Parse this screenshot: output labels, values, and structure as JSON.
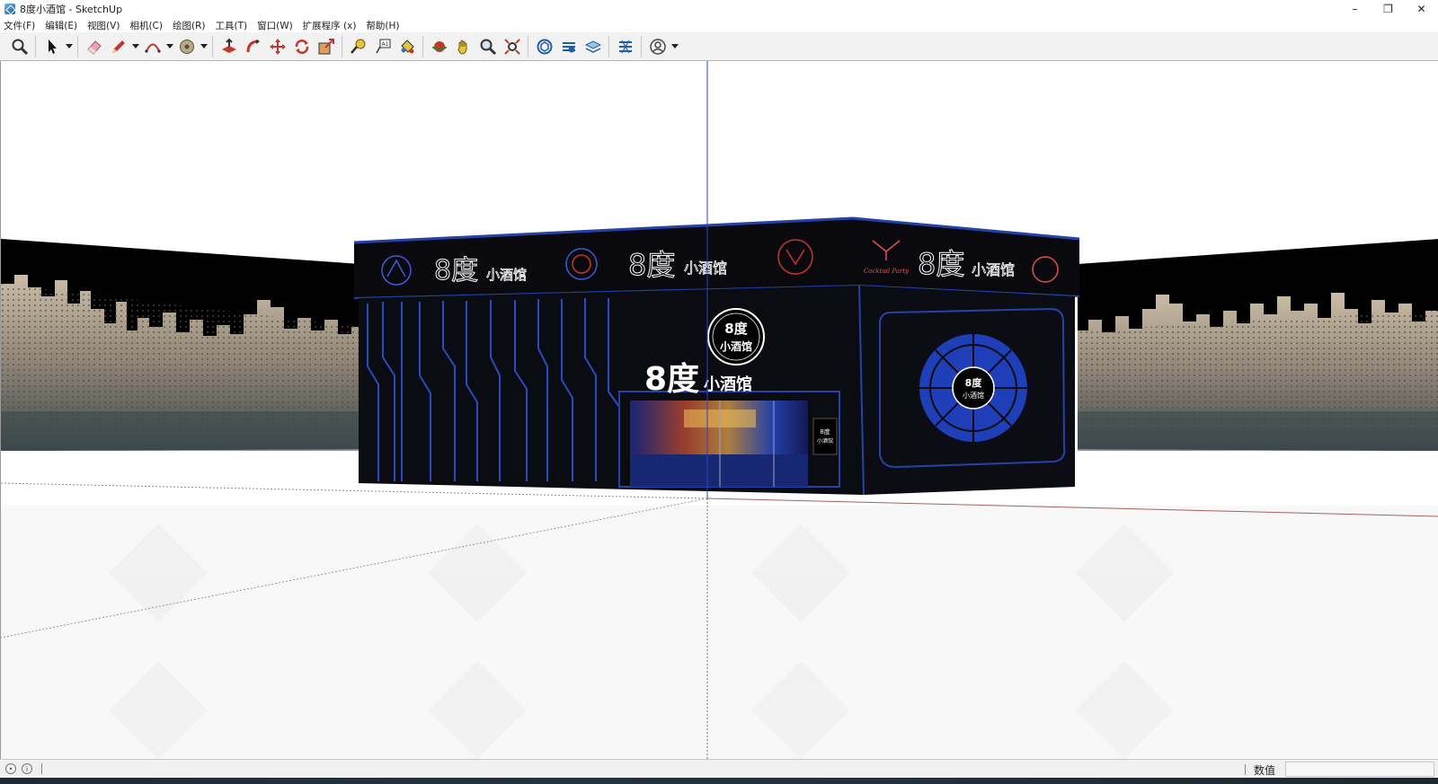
{
  "window": {
    "title": "8度小酒馆 - SketchUp",
    "controls": {
      "minimize": "–",
      "maximize": "❐",
      "close": "✕"
    }
  },
  "menu": {
    "items": [
      {
        "label": "文件(F)"
      },
      {
        "label": "编辑(E)"
      },
      {
        "label": "视图(V)"
      },
      {
        "label": "相机(C)"
      },
      {
        "label": "绘图(R)"
      },
      {
        "label": "工具(T)"
      },
      {
        "label": "窗口(W)"
      },
      {
        "label": "扩展程序 (x)"
      },
      {
        "label": "帮助(H)"
      }
    ]
  },
  "toolbar": {
    "icons": [
      "zoom-icon",
      "select-icon",
      "eraser-icon",
      "line-pencil-icon",
      "arc-icon",
      "circle-icon",
      "push-pull-icon",
      "follow-me-icon",
      "move-icon",
      "rotate-icon",
      "scale-icon",
      "tape-measure-icon",
      "text-label-icon",
      "paint-bucket-icon",
      "orbit-icon",
      "pan-icon",
      "zoom-view-icon",
      "zoom-extents-icon",
      "3d-warehouse-icon",
      "extension-warehouse-icon",
      "layout-icon",
      "extension-manager-icon",
      "account-icon"
    ]
  },
  "scene": {
    "signs": {
      "brand_main": "8度",
      "brand_sub": "小酒馆",
      "badge_top": "8度",
      "badge_bottom": "小酒馆",
      "round_logo_top": "8度",
      "round_logo_bottom": "小酒馆",
      "door_sign_top": "8度",
      "door_sign_bottom": "小酒馆",
      "neon_cocktail": "Cocktail Party"
    },
    "colors": {
      "facade": "#0b0c12",
      "trim_blue": "#2442a8",
      "disc_blue": "#1e3fb8",
      "backdrop": "#000000"
    }
  },
  "status": {
    "vcb_label": "数值",
    "vcb_value": ""
  }
}
